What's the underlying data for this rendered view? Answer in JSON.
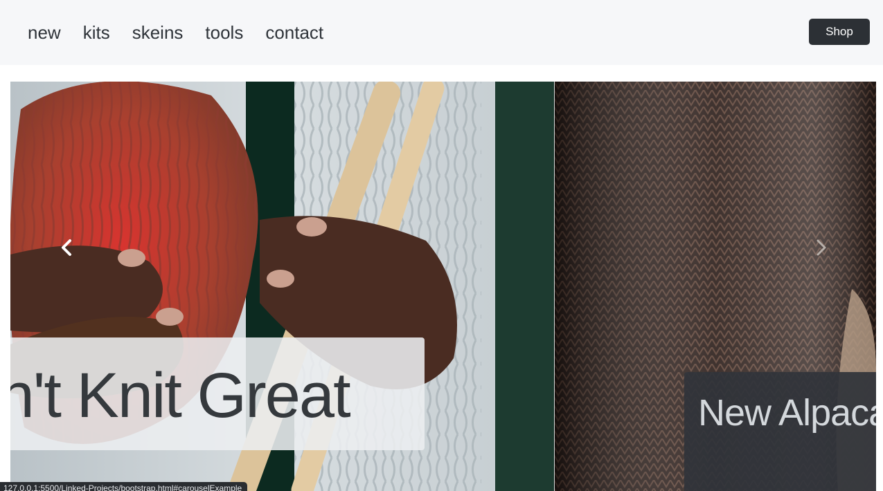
{
  "nav": {
    "links": [
      "new",
      "kits",
      "skeins",
      "tools",
      "contact"
    ],
    "shop_label": "Shop"
  },
  "carousel": {
    "slides": [
      {
        "caption": "Don't Knit Great"
      },
      {
        "caption": "New Alpaca"
      }
    ],
    "prev_icon": "chevron-left-icon",
    "next_icon": "chevron-right-icon"
  },
  "status_url": "127.0.0.1:5500/Linked-Projects/bootstrap.html#carouselExample",
  "colors": {
    "navbar_bg": "#f6f7f9",
    "shop_button_bg": "#2c3035",
    "nav_text": "#2e3339"
  }
}
